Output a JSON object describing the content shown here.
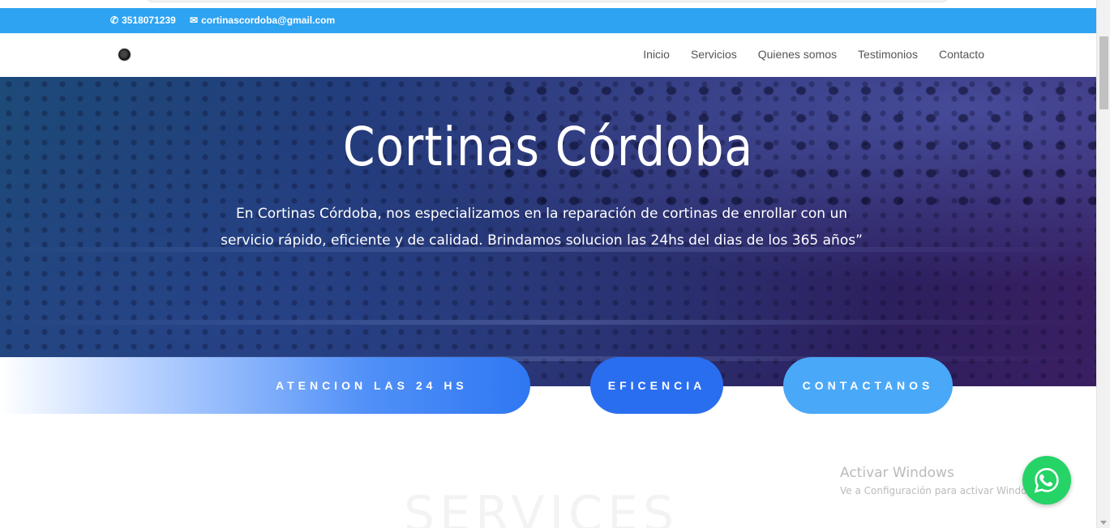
{
  "contact_bar": {
    "phone": "3518071239",
    "email": "cortinascordoba@gmail.com",
    "background": "#2ea3f2",
    "phone_icon": "phone-icon",
    "email_icon": "envelope-icon"
  },
  "nav": {
    "logo_icon": "site-logo",
    "items": [
      {
        "label": "Inicio"
      },
      {
        "label": "Servicios"
      },
      {
        "label": "Quienes somos"
      },
      {
        "label": "Testimonios"
      },
      {
        "label": "Contacto"
      }
    ]
  },
  "hero": {
    "title": "Cortinas Córdoba",
    "text": "En Cortinas Córdoba, nos especializamos en la reparación de cortinas de enrollar con un servicio rápido, eficiente y de calidad. Brindamos solucion las 24hs del dias de los 365 años”"
  },
  "buttons": [
    {
      "label": "ATENCION LAS 24 HS",
      "color": "#2f77f2"
    },
    {
      "label": "EFICENCIA",
      "color": "#2a6ef0"
    },
    {
      "label": "CONTACTANOS",
      "color": "#4aa8f8"
    }
  ],
  "section": {
    "ghost_heading": "SERVICES"
  },
  "windows_watermark": {
    "line1": "Activar Windows",
    "line2": "Ve a Configuración para activar Windows."
  },
  "whatsapp": {
    "icon": "whatsapp-icon",
    "color": "#25d366"
  }
}
